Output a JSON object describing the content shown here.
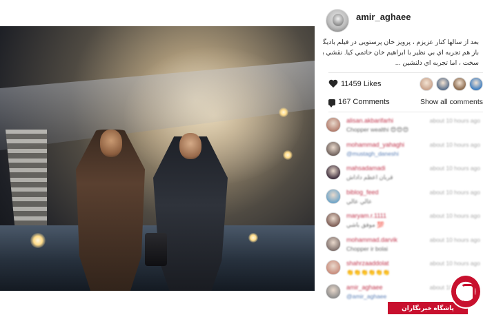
{
  "post": {
    "username": "amir_aghaee",
    "caption_lines": [
      "بعد از سالها کنار عزیزم ، پرویز خان پرستویی در فیلم بادیگارد.",
      "باز هم تجربه اي بي نظير با ابراهيم خان حاتمي كيا. نقشي به غايت",
      "سخت ، اما تجربه اي دلنشين ..."
    ],
    "likes": "11459 Likes",
    "comments_count": "167 Comments",
    "show_all": "Show all comments"
  },
  "colors": {
    "username_link": "#c0354c",
    "watermark_red": "#c8102e",
    "liker_avatars": [
      "#c9a38c",
      "#5a6f8a",
      "#8a6a4e",
      "#3f7dbf"
    ],
    "comment_avatars": [
      "#b07a6a",
      "#6d5f5a",
      "#3a2a3a",
      "#6aa3c8",
      "#7a5a52",
      "#7d6e6a",
      "#c78a7a",
      "#8a8a8a"
    ]
  },
  "comments": [
    {
      "user": "alisan.akbarifarhi",
      "time": "about 10 hours ago",
      "text": "Chopper wealthi 😍😍😍"
    },
    {
      "user": "mohammad_yahaghi",
      "time": "about 10 hours ago",
      "text": "@mustagh_daneshi"
    },
    {
      "user": "mahsadamadi",
      "time": "about 10 hours ago",
      "text": "قربان اعظم داداش"
    },
    {
      "user": "biblog_feed",
      "time": "about 10 hours ago",
      "text": "عالي عالي"
    },
    {
      "user": "maryam.r.1111",
      "time": "about 10 hours ago",
      "text": "موفق باشي 💯"
    },
    {
      "user": "mohammad.darvik",
      "time": "about 10 hours ago",
      "text": "Chopper ir bolai"
    },
    {
      "user": "shahrzaaddolat",
      "time": "about 10 hours ago",
      "text": "👏👏👏👏👏👏"
    },
    {
      "user": "amir_aghaee",
      "time": "about 10 hours ago",
      "text": "@amir_aghaee"
    }
  ],
  "watermark": {
    "text": "پاشگاه خبرنگاران"
  }
}
